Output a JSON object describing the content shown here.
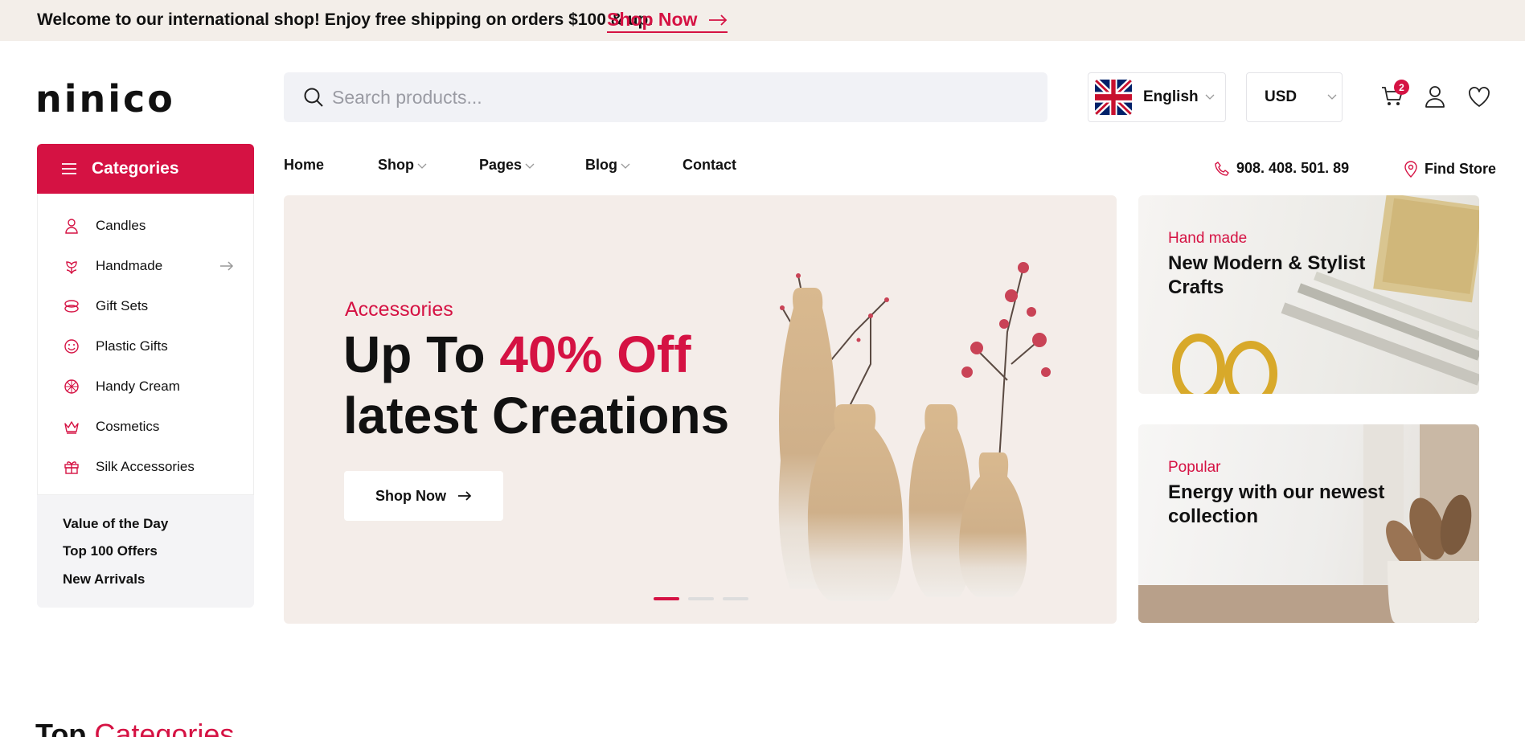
{
  "topbar": {
    "message": "Welcome to our international shop! Enjoy free shipping on orders $100 & up.",
    "link_label": "Shop Now"
  },
  "header": {
    "logo": "ninico",
    "search_placeholder": "Search products...",
    "language": "English",
    "currency": "USD",
    "cart_count": "2"
  },
  "categories": {
    "title": "Categories",
    "items": [
      {
        "label": "Candles",
        "icon": "person-icon"
      },
      {
        "label": "Handmade",
        "icon": "flower-icon"
      },
      {
        "label": "Gift Sets",
        "icon": "ring-icon"
      },
      {
        "label": "Plastic Gifts",
        "icon": "smile-icon"
      },
      {
        "label": "Handy Cream",
        "icon": "ball-icon"
      },
      {
        "label": "Cosmetics",
        "icon": "crown-icon"
      },
      {
        "label": "Silk Accessories",
        "icon": "gift-icon"
      }
    ],
    "links": [
      "Value of the Day",
      "Top 100 Offers",
      "New Arrivals"
    ]
  },
  "nav": {
    "items": [
      "Home",
      "Shop",
      "Pages",
      "Blog",
      "Contact"
    ],
    "phone": "908. 408. 501. 89",
    "find_store": "Find Store"
  },
  "hero": {
    "eyebrow": "Accessories",
    "title_line1_pre": "Up To ",
    "title_line1_accent": "40% Off",
    "title_line2": "latest Creations",
    "button": "Shop Now",
    "slides": 3,
    "active_slide": 1
  },
  "banners": [
    {
      "eyebrow": "Hand made",
      "title": "New Modern & Stylist Crafts"
    },
    {
      "eyebrow": "Popular",
      "title": "Energy with our newest collection"
    }
  ],
  "section": {
    "title_main": "Top",
    "title_accent": "Categories"
  },
  "colors": {
    "accent": "#d51243",
    "topbar_bg": "#f3eee9",
    "hero_bg": "#f4ede9"
  }
}
